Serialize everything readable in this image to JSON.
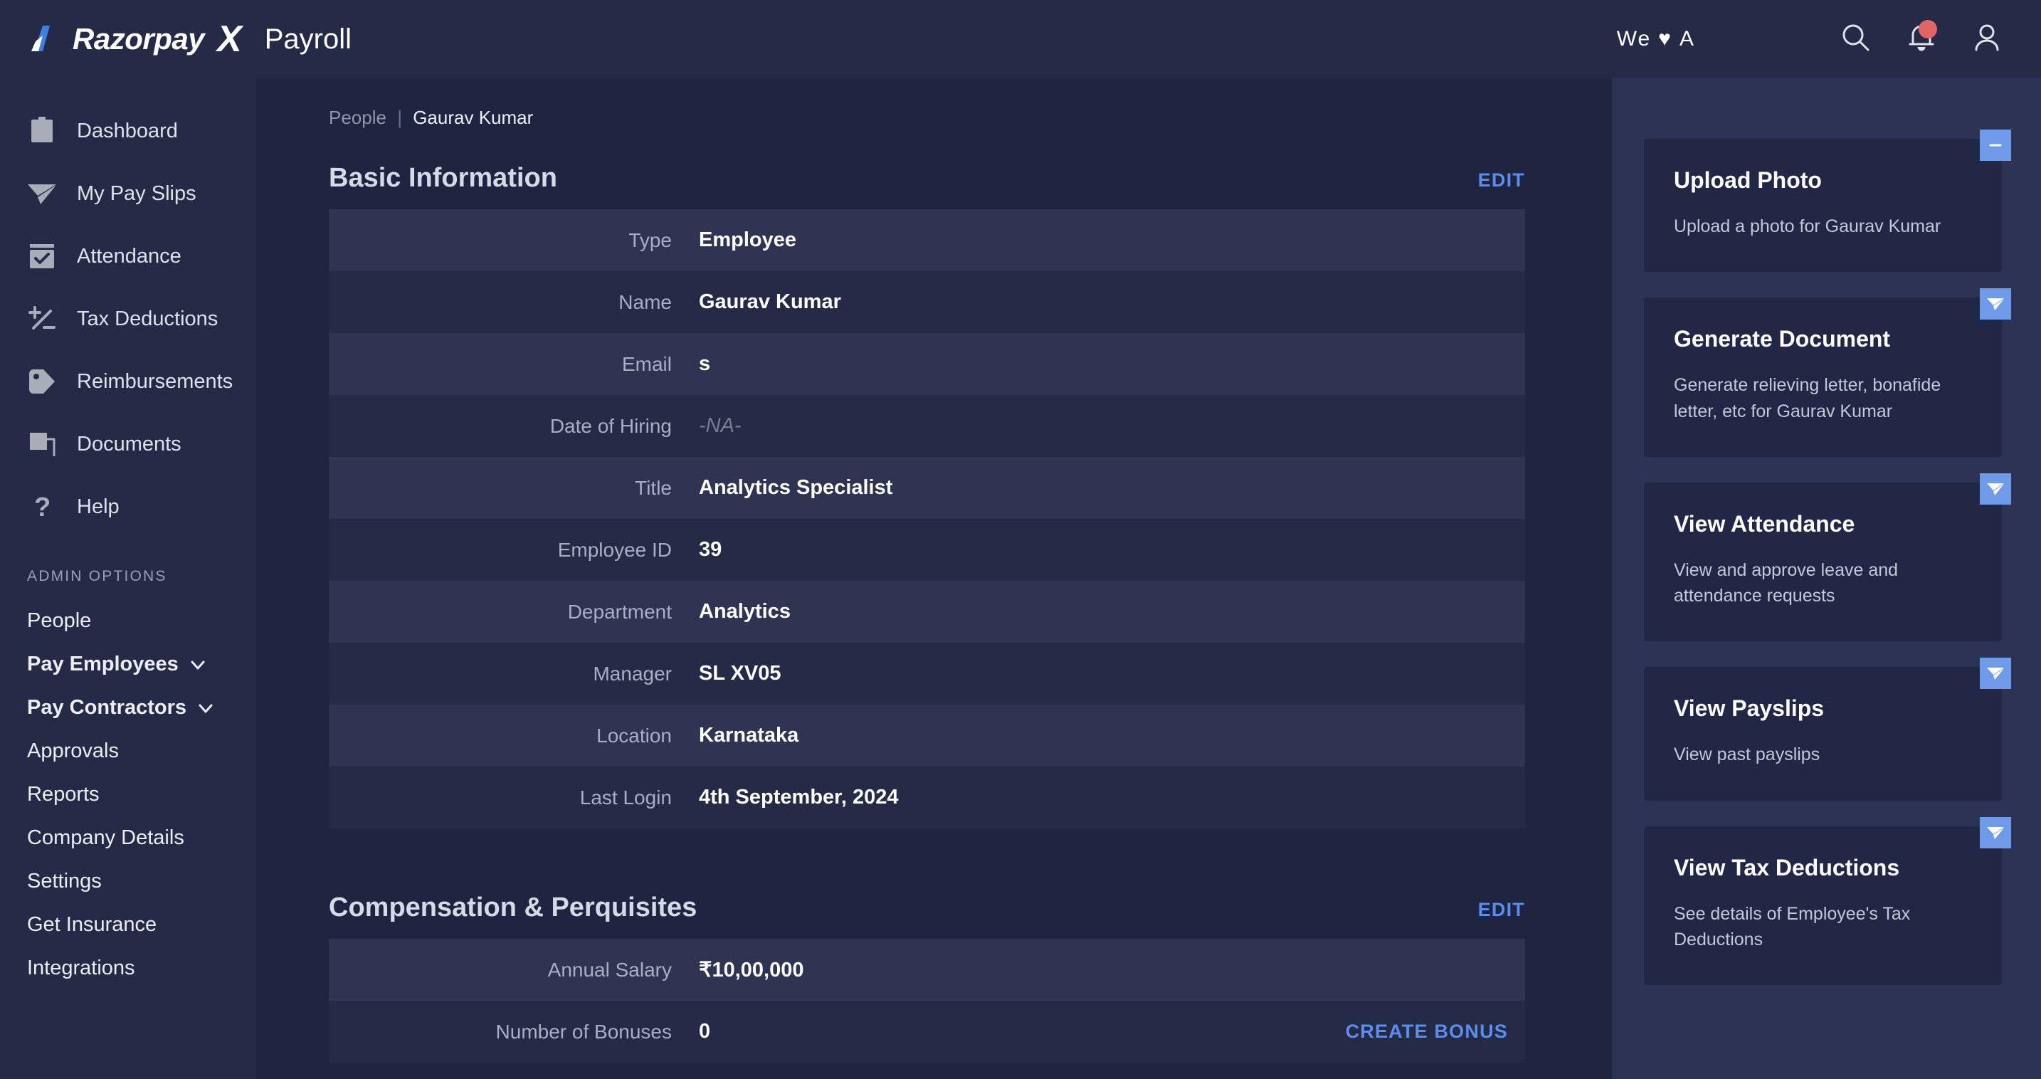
{
  "header": {
    "logo_brand": "Razorpay",
    "logo_x": "X",
    "logo_product": "Payroll",
    "we_love_prefix": "We",
    "we_love_heart": "♥",
    "we_love_suffix": "A",
    "search_icon": "search-icon",
    "notifications_icon": "bell-icon",
    "profile_icon": "user-icon"
  },
  "sidebar": {
    "items": [
      {
        "label": "Dashboard",
        "icon": "clipboard-icon"
      },
      {
        "label": "My Pay Slips",
        "icon": "paper-plane-icon"
      },
      {
        "label": "Attendance",
        "icon": "calendar-check-icon"
      },
      {
        "label": "Tax Deductions",
        "icon": "plus-minus-icon"
      },
      {
        "label": "Reimbursements",
        "icon": "tag-icon"
      },
      {
        "label": "Documents",
        "icon": "documents-icon"
      },
      {
        "label": "Help",
        "icon": "question-mark-icon"
      }
    ],
    "admin_heading": "ADMIN OPTIONS",
    "admin_items": [
      {
        "label": "People",
        "bold": false,
        "chevron": false
      },
      {
        "label": "Pay Employees",
        "bold": true,
        "chevron": true
      },
      {
        "label": "Pay Contractors",
        "bold": true,
        "chevron": true
      },
      {
        "label": "Approvals",
        "bold": false,
        "chevron": false
      },
      {
        "label": "Reports",
        "bold": false,
        "chevron": false
      },
      {
        "label": "Company Details",
        "bold": false,
        "chevron": false
      },
      {
        "label": "Settings",
        "bold": false,
        "chevron": false
      },
      {
        "label": "Get Insurance",
        "bold": false,
        "chevron": false
      },
      {
        "label": "Integrations",
        "bold": false,
        "chevron": false
      }
    ]
  },
  "breadcrumb": {
    "parent": "People",
    "separator": "|",
    "current": "Gaurav Kumar"
  },
  "basic_information": {
    "title": "Basic Information",
    "edit_label": "EDIT",
    "rows": [
      {
        "label": "Type",
        "value": "Employee",
        "na": false
      },
      {
        "label": "Name",
        "value": "Gaurav Kumar",
        "na": false
      },
      {
        "label": "Email",
        "value": "s",
        "na": false
      },
      {
        "label": "Date of Hiring",
        "value": "-NA-",
        "na": true
      },
      {
        "label": "Title",
        "value": "Analytics Specialist",
        "na": false
      },
      {
        "label": "Employee ID",
        "value": "39",
        "na": false
      },
      {
        "label": "Department",
        "value": "Analytics",
        "na": false
      },
      {
        "label": "Manager",
        "value": "SL XV05",
        "na": false
      },
      {
        "label": "Location",
        "value": "Karnataka",
        "na": false
      },
      {
        "label": "Last Login",
        "value": "4th September, 2024",
        "na": false
      }
    ]
  },
  "compensation": {
    "title": "Compensation & Perquisites",
    "edit_label": "EDIT",
    "rows": [
      {
        "label": "Annual Salary",
        "value": "₹10,00,000",
        "action": ""
      },
      {
        "label": "Number of Bonuses",
        "value": "0",
        "action": "CREATE BONUS"
      }
    ]
  },
  "right_panel": {
    "cards": [
      {
        "title": "Upload Photo",
        "desc": "Upload a photo for Gaurav Kumar",
        "badge_icon": "minus-icon"
      },
      {
        "title": "Generate Document",
        "desc": "Generate relieving letter, bonafide letter, etc for Gaurav Kumar",
        "badge_icon": "paper-plane-icon"
      },
      {
        "title": "View Attendance",
        "desc": "View and approve leave and attendance requests",
        "badge_icon": "paper-plane-icon"
      },
      {
        "title": "View Payslips",
        "desc": "View past payslips",
        "badge_icon": "paper-plane-icon"
      },
      {
        "title": "View Tax Deductions",
        "desc": "See details of Employee's Tax Deductions",
        "badge_icon": "paper-plane-icon"
      }
    ]
  },
  "colors": {
    "accent_blue": "#5b8def",
    "badge_blue": "#6f9ae8",
    "notification_red": "#e06666",
    "sidebar_bg": "#252b47",
    "content_bg": "#1f2440",
    "right_panel_bg": "#2d3354",
    "card_bg": "#222745",
    "row_odd": "#2f3452"
  }
}
